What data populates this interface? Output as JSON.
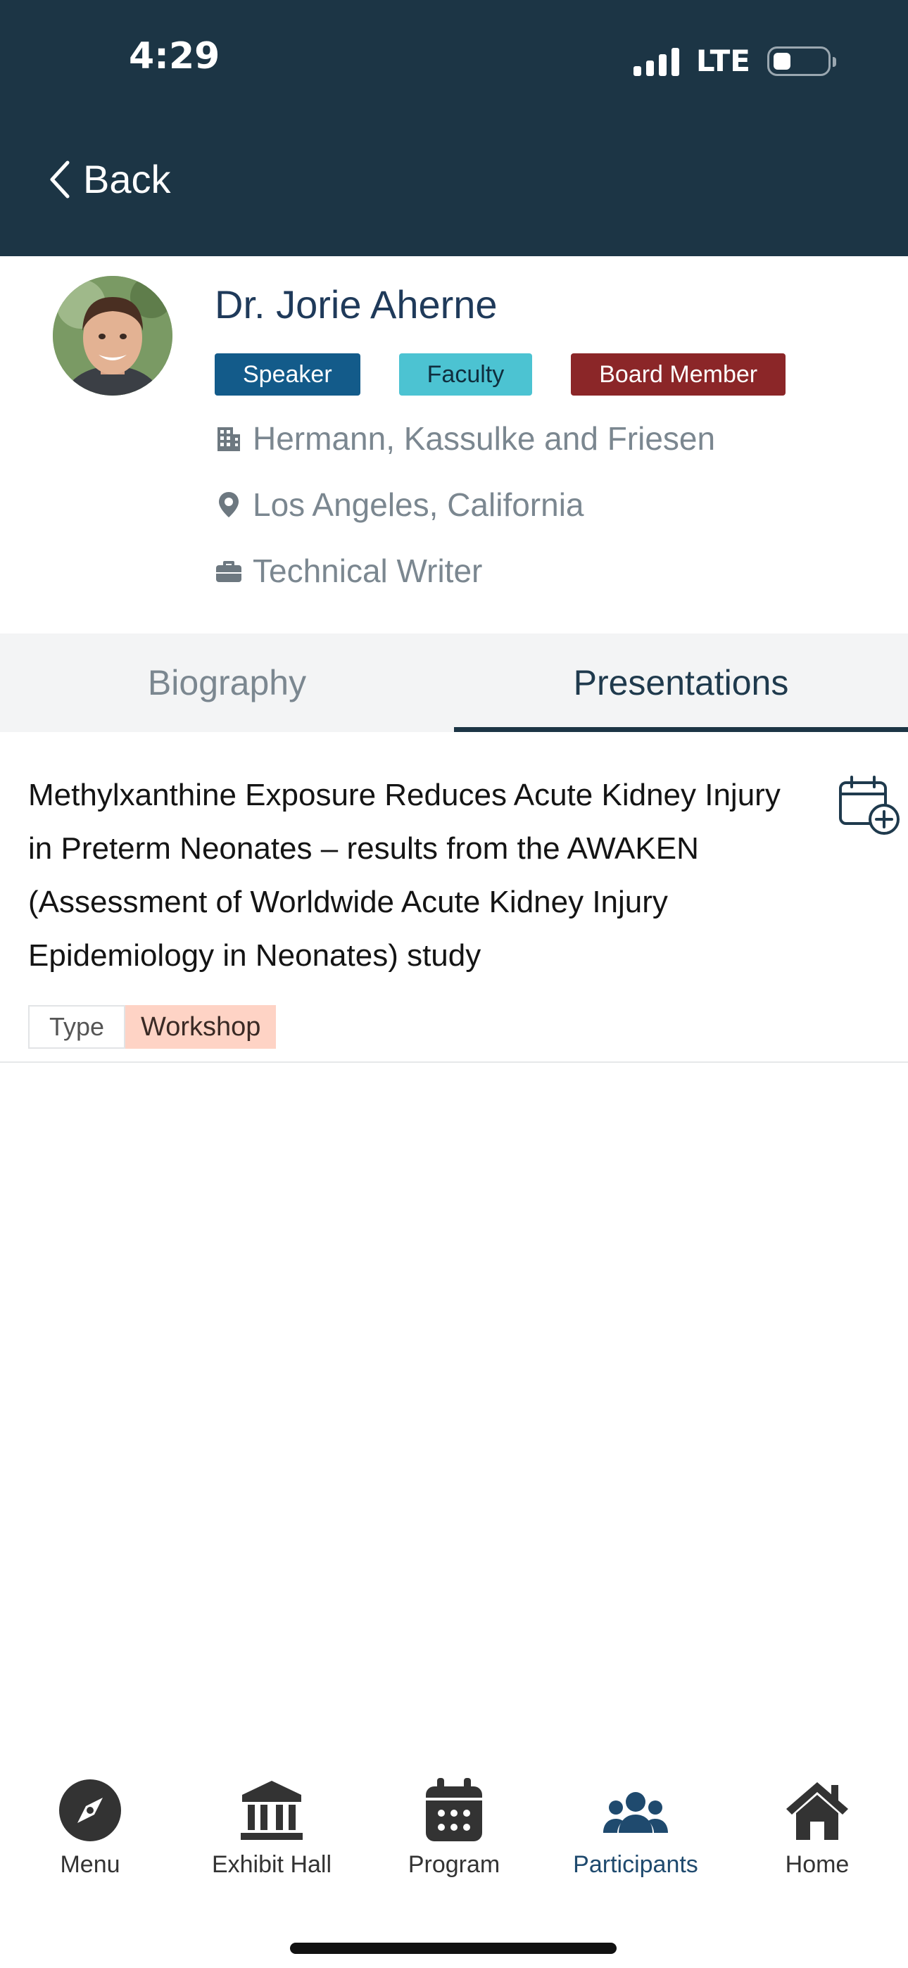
{
  "status_bar": {
    "time": "4:29",
    "network": "LTE"
  },
  "header": {
    "back_label": "Back"
  },
  "profile": {
    "name": "Dr. Jorie Aherne",
    "badges": [
      "Speaker",
      "Faculty",
      "Board Member"
    ],
    "organization": "Hermann, Kassulke and Friesen",
    "location": "Los Angeles, California",
    "job_title": "Technical Writer"
  },
  "tabs": [
    {
      "label": "Biography",
      "active": false
    },
    {
      "label": "Presentations",
      "active": true
    }
  ],
  "presentations": [
    {
      "title": "Methylxanthine Exposure Reduces Acute Kidney Injury in Preterm Neonates – results from the AWAKEN (Assessment of Worldwide Acute Kidney Injury Epidemiology in Neonates) study",
      "type_label": "Type",
      "type_value": "Workshop"
    }
  ],
  "bottom_nav": [
    {
      "label": "Menu",
      "icon": "compass-icon"
    },
    {
      "label": "Exhibit Hall",
      "icon": "building-columns-icon"
    },
    {
      "label": "Program",
      "icon": "calendar-icon"
    },
    {
      "label": "Participants",
      "icon": "users-icon",
      "active": true
    },
    {
      "label": "Home",
      "icon": "home-icon"
    }
  ],
  "colors": {
    "header_bg": "#1c3545",
    "speaker_badge": "#135b8a",
    "faculty_badge": "#4cc3d2",
    "board_badge": "#8b2628",
    "type_tag": "#fed3c5"
  }
}
